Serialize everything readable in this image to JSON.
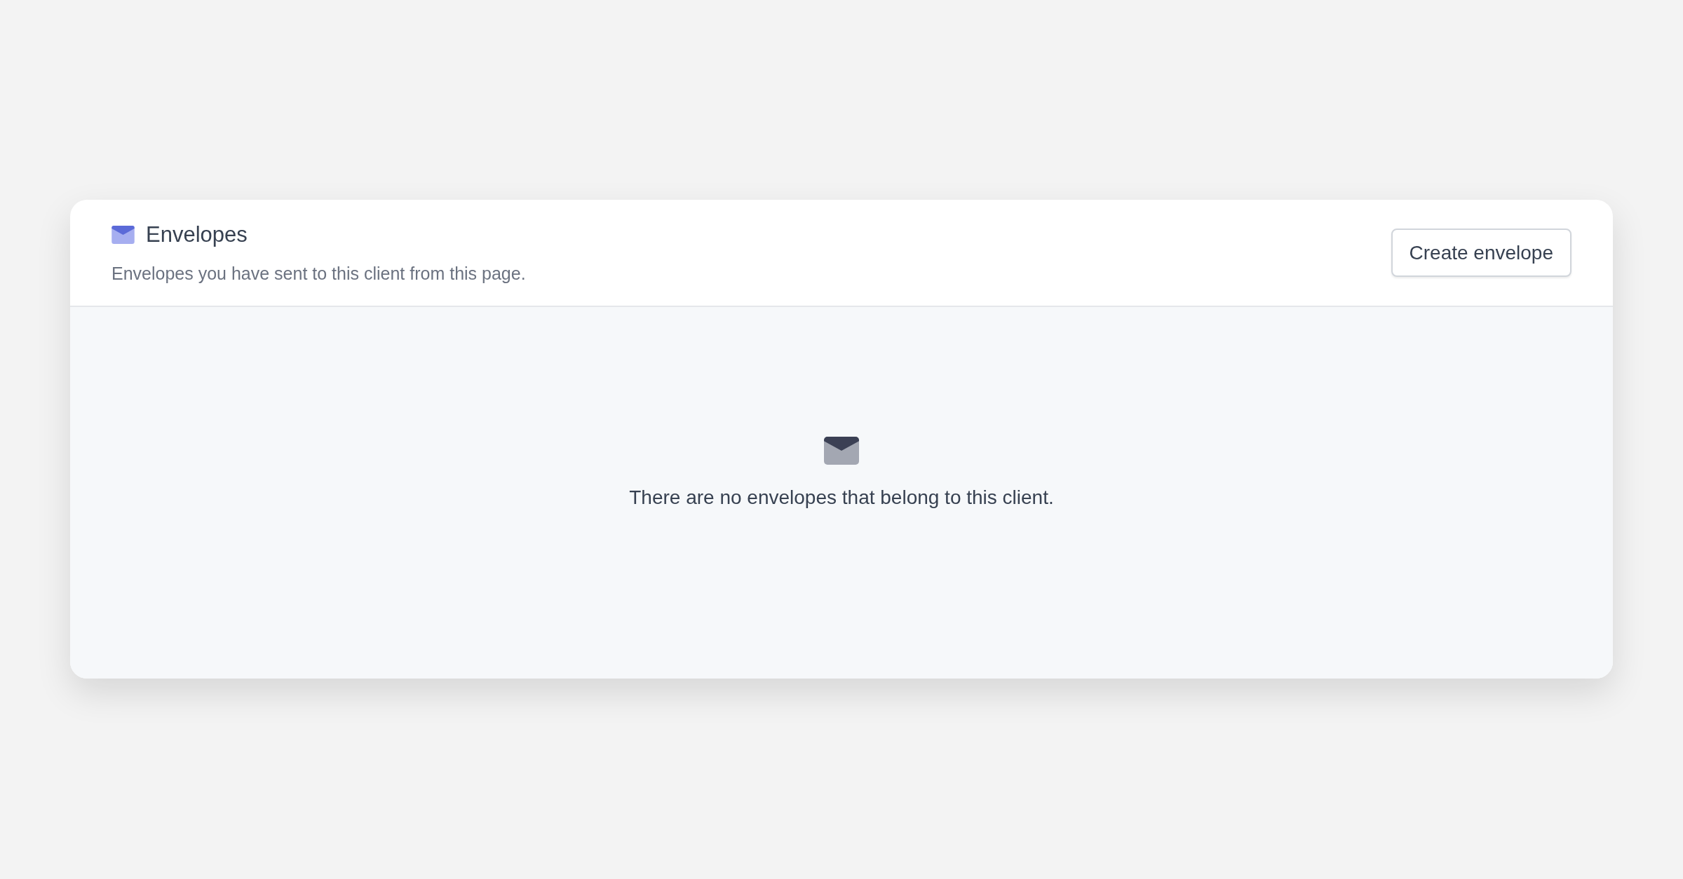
{
  "card": {
    "title": "Envelopes",
    "subtitle": "Envelopes you have sent to this client from this page.",
    "button": "Create envelope"
  },
  "empty_state": {
    "message": "There are no envelopes that belong to this client."
  }
}
